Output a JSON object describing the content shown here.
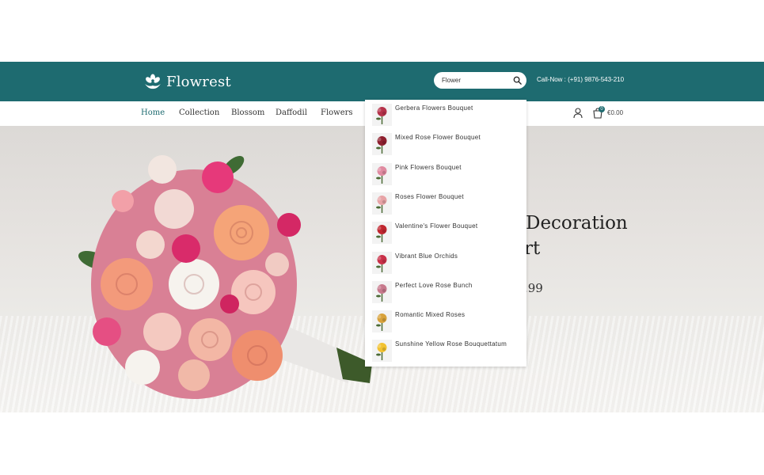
{
  "header": {
    "logo_text": "Flowrest",
    "search": {
      "value": "Flower",
      "placeholder": "Flower"
    },
    "call_now": "Call-Now : (+91) 9876-543-210"
  },
  "nav": {
    "items": [
      {
        "label": "Home",
        "active": true
      },
      {
        "label": "Collection"
      },
      {
        "label": "Blossom"
      },
      {
        "label": "Daffodil"
      },
      {
        "label": "Flowers"
      }
    ],
    "cart_count": "0",
    "cart_total": "€0.00"
  },
  "hero": {
    "title_line1": "Decoration",
    "title_line2": "rt",
    "price": ".99"
  },
  "search_results": [
    {
      "label": "Gerbera Flowers Bouquet",
      "color": "#b5324a"
    },
    {
      "label": "Mixed Rose Flower Bouquet",
      "color": "#8e1f2e"
    },
    {
      "label": "Pink Flowers Bouquet",
      "color": "#e08aa0"
    },
    {
      "label": "Roses Flower Bouquet",
      "color": "#e7a3a6"
    },
    {
      "label": "Valentine's Flower Bouquet",
      "color": "#c0262f"
    },
    {
      "label": "Vibrant Blue Orchids",
      "color": "#c93048"
    },
    {
      "label": "Perfect Love Rose Bunch",
      "color": "#c7798c"
    },
    {
      "label": "Romantic Mixed Roses",
      "color": "#d8a23b"
    },
    {
      "label": "Sunshine Yellow Rose Bouquettatum",
      "color": "#f2c230"
    }
  ],
  "colors": {
    "brand": "#1e6b70"
  }
}
